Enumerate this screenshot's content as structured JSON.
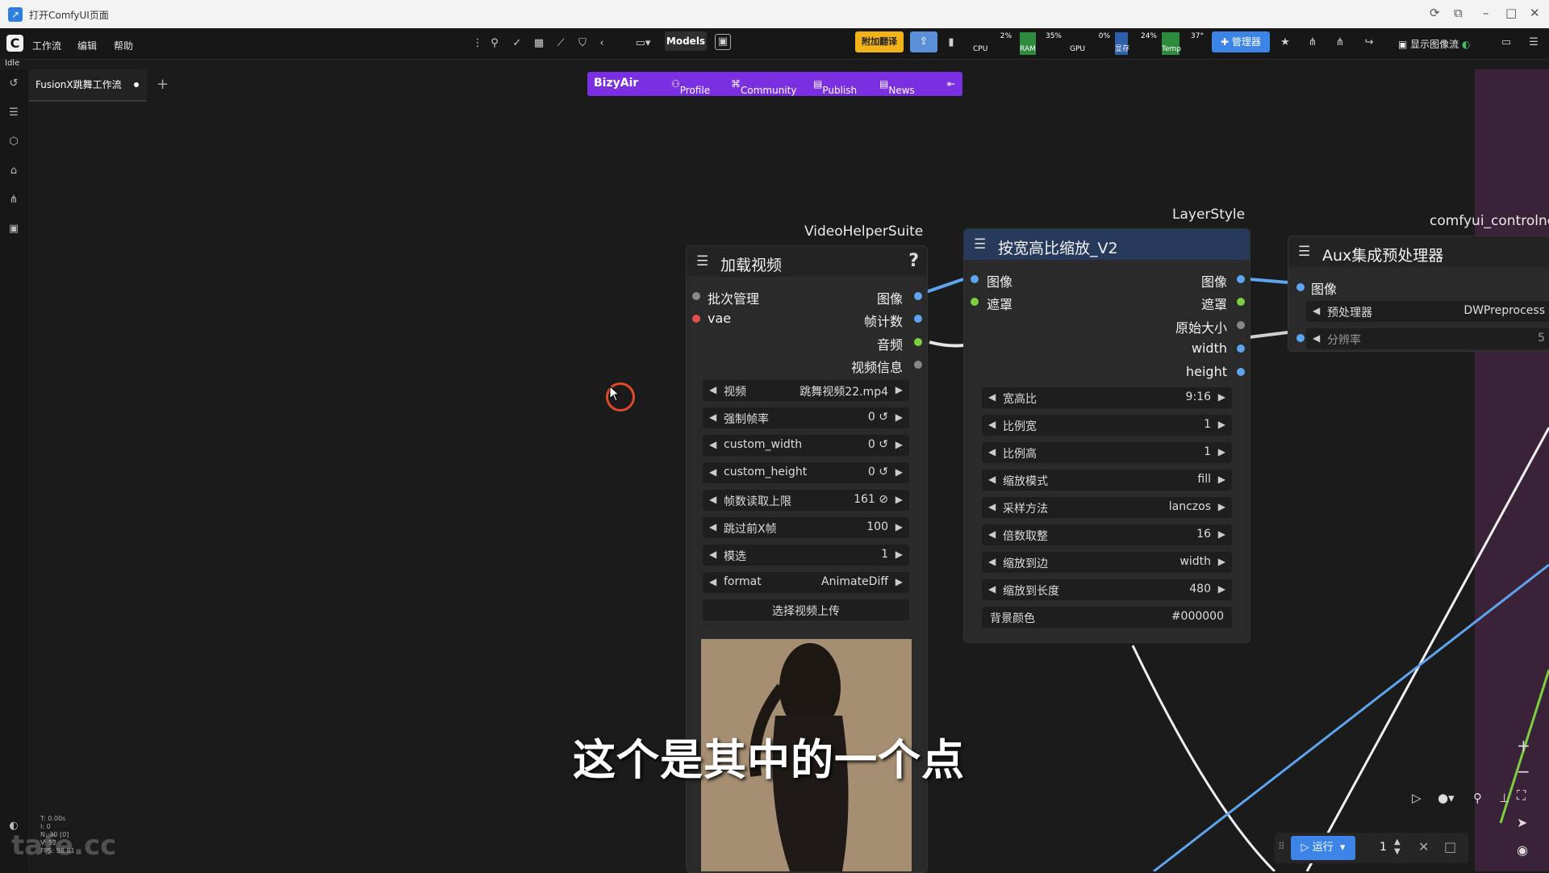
{
  "window": {
    "title": "打开ComfyUI页面"
  },
  "menu": {
    "items": [
      "工作流",
      "编辑",
      "帮助"
    ]
  },
  "status": {
    "idle": "Idle"
  },
  "toolbar": {
    "models_label": "Models",
    "translate_label": "附加翻译",
    "manager_label": "管理器",
    "show_image_label": "显示图像流"
  },
  "monitor": {
    "cpu": {
      "label": "CPU",
      "value": "2%"
    },
    "ram": {
      "label": "RAM",
      "value": "35%"
    },
    "gpu": {
      "label": "GPU",
      "value": "0%"
    },
    "vram": {
      "label": "显存",
      "value": "24%"
    },
    "temp": {
      "label": "Temp",
      "value": "37°"
    }
  },
  "tab": {
    "name": "FusionX跳舞工作流"
  },
  "bizyair": {
    "brand": "BizyAir",
    "profile": "Profile",
    "community": "Community",
    "publish": "Publish",
    "news": "News"
  },
  "nodes": {
    "load_video": {
      "source": "VideoHelperSuite",
      "title": "加载视频",
      "inputs": [
        "批次管理",
        "vae"
      ],
      "outputs": [
        "图像",
        "帧计数",
        "音频",
        "视频信息"
      ],
      "widgets": [
        {
          "name": "视频",
          "value": "跳舞视频22.mp4"
        },
        {
          "name": "强制帧率",
          "value": "0 ↺"
        },
        {
          "name": "custom_width",
          "value": "0 ↺"
        },
        {
          "name": "custom_height",
          "value": "0 ↺"
        },
        {
          "name": "帧数读取上限",
          "value": "161 ⊘"
        },
        {
          "name": "跳过前X帧",
          "value": "100"
        },
        {
          "name": "模选",
          "value": "1"
        },
        {
          "name": "format",
          "value": "AnimateDiff"
        }
      ],
      "upload_button": "选择视频上传"
    },
    "scale_ratio": {
      "source": "LayerStyle",
      "title": "按宽高比缩放_V2",
      "inputs": [
        "图像",
        "遮罩"
      ],
      "outputs": [
        "图像",
        "遮罩",
        "原始大小",
        "width",
        "height"
      ],
      "widgets": [
        {
          "name": "宽高比",
          "value": "9:16"
        },
        {
          "name": "比例宽",
          "value": "1"
        },
        {
          "name": "比例高",
          "value": "1"
        },
        {
          "name": "缩放模式",
          "value": "fill"
        },
        {
          "name": "采样方法",
          "value": "lanczos"
        },
        {
          "name": "倍数取整",
          "value": "16"
        },
        {
          "name": "缩放到边",
          "value": "width"
        },
        {
          "name": "缩放到长度",
          "value": "480"
        },
        {
          "name": "背景颜色",
          "value": "#000000"
        }
      ]
    },
    "aux": {
      "source": "comfyui_controlne",
      "title": "Aux集成预处理器",
      "inputs": [
        "图像"
      ],
      "widgets": [
        {
          "name": "预处理器",
          "value": "DWPreprocess"
        },
        {
          "name": "分辨率",
          "value": "5"
        }
      ]
    }
  },
  "subtitle": "这个是其中的一个点",
  "watermark": "tafe.cc",
  "runbar": {
    "run_label": "运行",
    "count": "1"
  },
  "colors": {
    "accent": "#3c84e8",
    "bizyair": "#7a2fe0",
    "translate": "#f1b21a"
  }
}
